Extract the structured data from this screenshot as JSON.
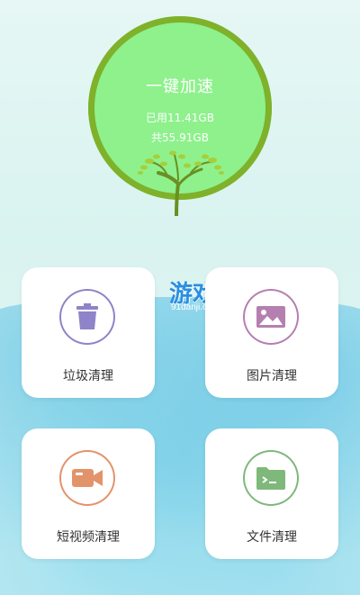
{
  "boost": {
    "title": "一键加速",
    "used": "已用11.41GB",
    "total": "共55.91GB"
  },
  "watermark": {
    "logo_number": "91",
    "logo_word": "游戏",
    "url": "91danji.com"
  },
  "cards": [
    {
      "label": "垃圾清理",
      "icon": "trash-icon",
      "color": "#8f83c9"
    },
    {
      "label": "图片清理",
      "icon": "image-icon",
      "color": "#b57fb0"
    },
    {
      "label": "短视频清理",
      "icon": "video-camera-icon",
      "color": "#e3936a"
    },
    {
      "label": "文件清理",
      "icon": "folder-icon",
      "color": "#7fb87b"
    }
  ],
  "colors": {
    "circle_fill": "#8ef18c",
    "circle_ring": "#7fb12a",
    "watercolor": "#bfe9f1"
  }
}
